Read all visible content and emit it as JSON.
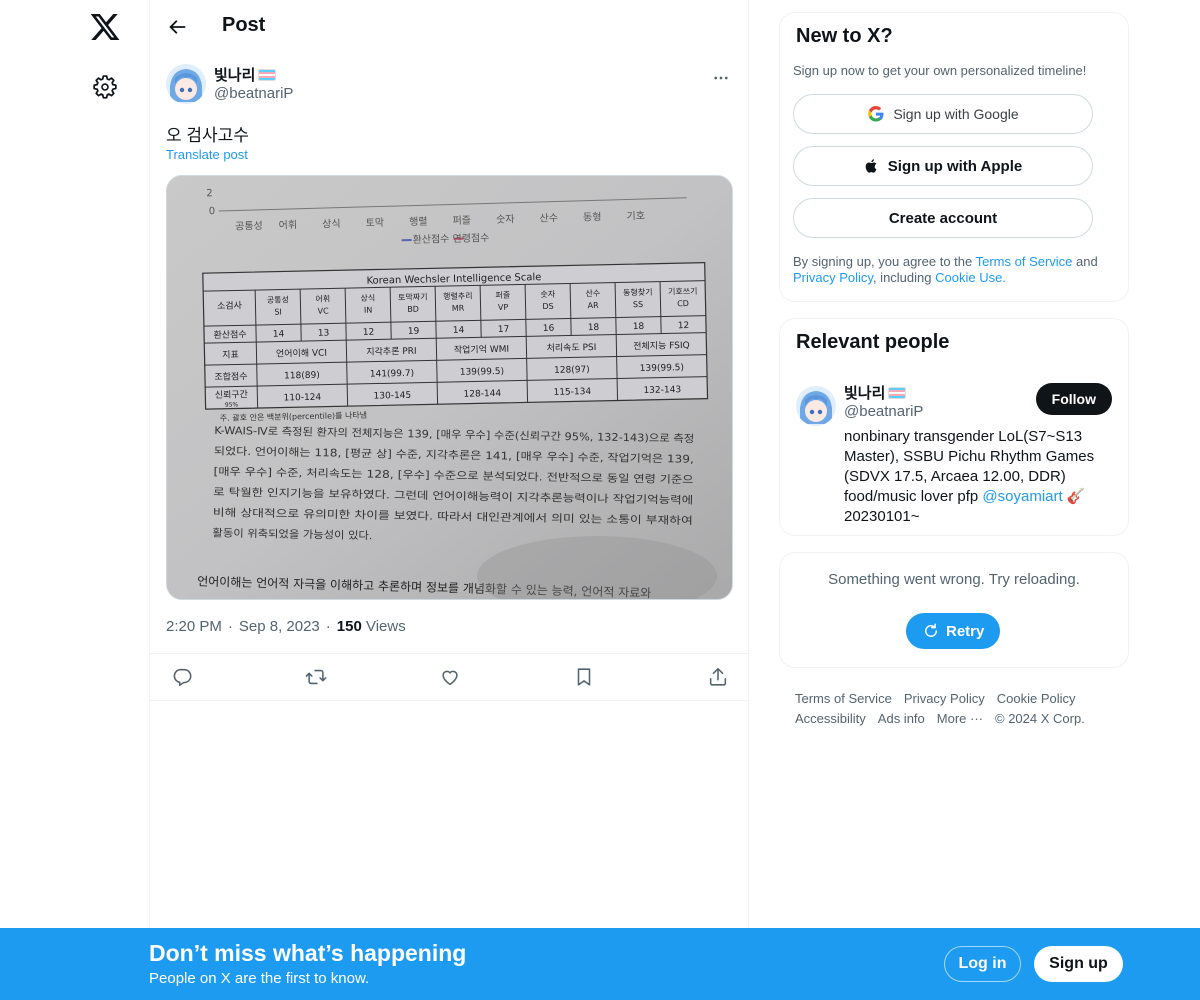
{
  "nav": {
    "logo_icon": "x-logo-icon",
    "settings_icon": "gear-icon"
  },
  "header": {
    "title": "Post",
    "back_icon": "arrow-left-icon"
  },
  "post": {
    "author_name": "빛나리",
    "author_handle": "@beatnariP",
    "text": "오 검사고수",
    "translate": "Translate post",
    "time": "2:20 PM",
    "date": "Sep 8, 2023",
    "views_count": "150",
    "views_label": "Views",
    "media": {
      "chart_axis_labels": [
        "2",
        "0"
      ],
      "chart_categories": [
        "공통성",
        "어휘",
        "상식",
        "토막",
        "행렬",
        "퍼즐",
        "숫자",
        "산수",
        "동형",
        "기호"
      ],
      "chart_legend": "환산점수  연령점수",
      "table_title": "Korean Wechsler Intelligence Scale",
      "row1_header": "소검사",
      "subtests": [
        [
          "공통성",
          "SI"
        ],
        [
          "어휘",
          "VC"
        ],
        [
          "상식",
          "IN"
        ],
        [
          "토막짜기",
          "BD"
        ],
        [
          "행렬추리",
          "MR"
        ],
        [
          "퍼즐",
          "VP"
        ],
        [
          "숫자",
          "DS"
        ],
        [
          "산수",
          "AR"
        ],
        [
          "동형찾기",
          "SS"
        ],
        [
          "기호쓰기",
          "CD"
        ]
      ],
      "row2_header": "환산점수",
      "scaled_scores": [
        "14",
        "13",
        "12",
        "19",
        "14",
        "17",
        "16",
        "18",
        "18",
        "12"
      ],
      "row3_header": "지표",
      "indices": [
        "언어이해 VCI",
        "지각추론 PRI",
        "작업기억 WMI",
        "처리속도 PSI",
        "전체지능 FSIQ"
      ],
      "row4_header": "조합점수",
      "composite": [
        "118(89)",
        "141(99.7)",
        "139(99.5)",
        "128(97)",
        "139(99.5)"
      ],
      "row5_header": "신뢰구간",
      "row5_sub": "95%",
      "confidence": [
        "110-124",
        "130-145",
        "128-144",
        "115-134",
        "132-143"
      ],
      "footnote": "주. 괄호 안은 백분위(percentile)를 나타냄",
      "body_lines": [
        "K-WAIS-Ⅳ로 측정된 환자의 전체지능은 139, [매우 우수] 수준(신뢰구간 95%, 132-143)으로 측정",
        "되었다. 언어이해는 118, [평균 상] 수준, 지각추론은 141, [매우 우수] 수준, 작업기억은 139,",
        "[매우 우수] 수준, 처리속도는 128, [우수] 수준으로 분석되었다. 전반적으로 동일 연령 기준으",
        "로 탁월한 인지기능을 보유하였다. 그런데 언어이해능력이 지각추론능력이나 작업기억능력에",
        "비해 상대적으로 유의미한 차이를 보였다. 따라서 대인관계에서 의미 있는 소통이 부재하여",
        "활동이 위축되었을 가능성이 있다."
      ],
      "bottom_line": "언어이해는 언어적 자극을 이해하고 추론하며 정보를 개념화할 수 있는 능력, 언어적 자료와"
    },
    "actions": [
      "reply-icon",
      "repost-icon",
      "like-icon",
      "bookmark-icon",
      "share-icon"
    ]
  },
  "signup_card": {
    "title": "New to X?",
    "subtitle": "Sign up now to get your own personalized timeline!",
    "google": "Sign up with Google",
    "apple": "Sign up with Apple",
    "create": "Create account",
    "terms_pre": "By signing up, you agree to the ",
    "terms_link": "Terms of Service",
    "terms_mid": " and ",
    "privacy_link": "Privacy Policy",
    "terms_mid2": ", including ",
    "cookie_link": "Cookie Use."
  },
  "people_card": {
    "title": "Relevant people",
    "name": "빛나리",
    "handle": "@beatnariP",
    "follow": "Follow",
    "bio_pre": "nonbinary transgender LoL(S7~S13 Master), SSBU Pichu Rhythm Games (SDVX 17.5, Arcaea 12.00, DDR) food/music lover pfp ",
    "bio_link": "@soyamiart",
    "bio_post": " 🎸 20230101~"
  },
  "error_card": {
    "text": "Something went wrong. Try reloading.",
    "retry": "Retry"
  },
  "footer": {
    "terms": "Terms of Service",
    "privacy": "Privacy Policy",
    "cookie": "Cookie Policy",
    "accessibility": "Accessibility",
    "ads": "Ads info",
    "more": "More ···",
    "copyright": "© 2024 X Corp."
  },
  "banner": {
    "title": "Don’t miss what’s happening",
    "subtitle": "People on X are the first to know.",
    "login": "Log in",
    "signup": "Sign up"
  },
  "colors": {
    "accent": "#1d9bf0",
    "text": "#0f1419",
    "muted": "#536471"
  }
}
